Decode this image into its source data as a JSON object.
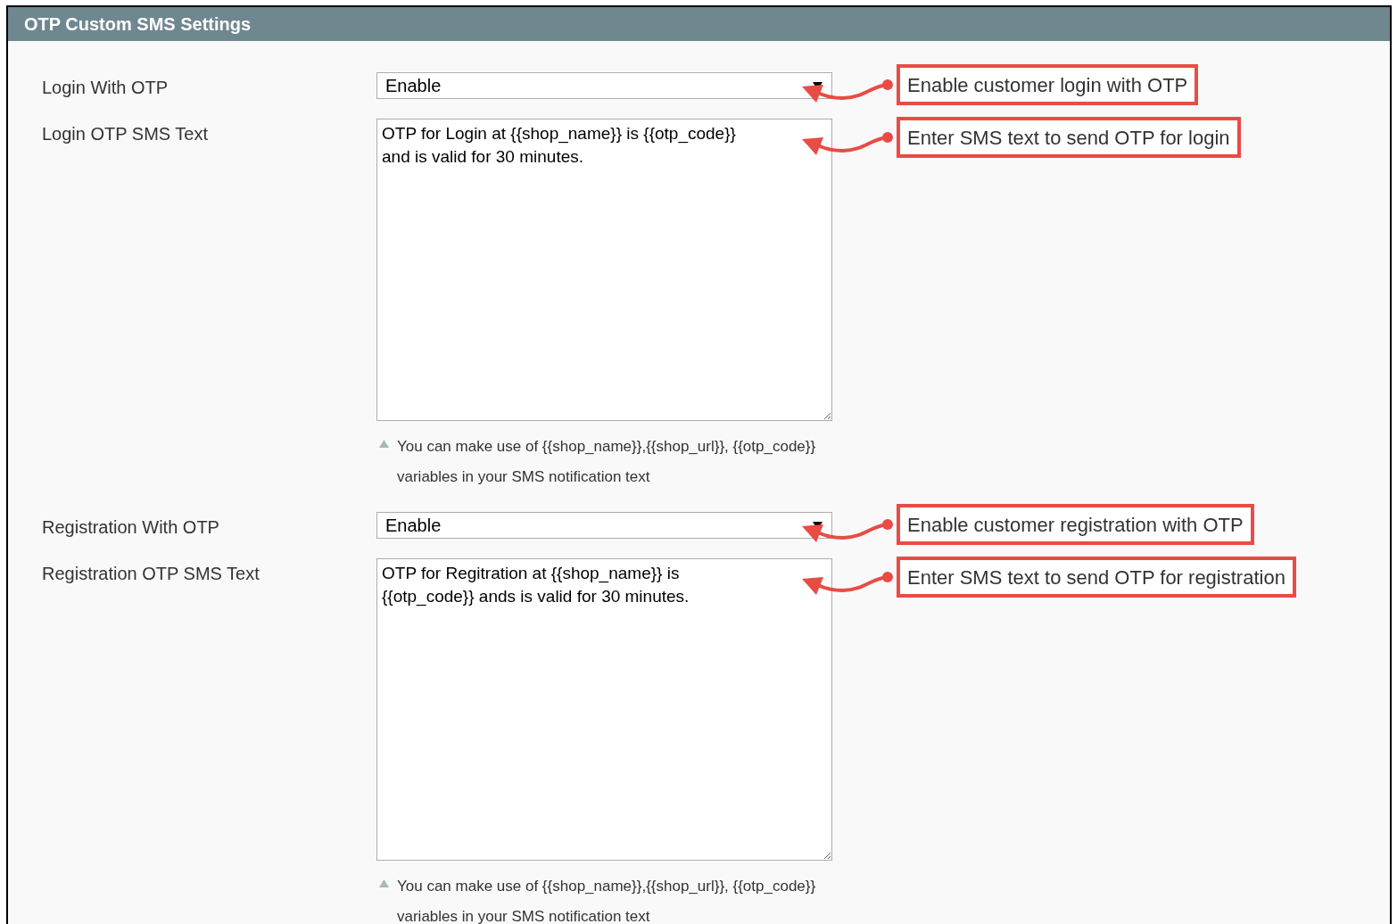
{
  "panel": {
    "title": "OTP Custom SMS Settings"
  },
  "fields": [
    {
      "kind": "select",
      "label": "Login With OTP",
      "value": "Enable",
      "callout": "Enable customer login with OTP"
    },
    {
      "kind": "textarea",
      "label": "Login OTP SMS Text",
      "value": "OTP for Login at {{shop_name}} is {{otp_code}}\nand is valid for 30 minutes.",
      "callout": "Enter SMS text to send OTP for login",
      "note": "You can make use of {{shop_name}},{{shop_url}}, {{otp_code}} variables in your SMS notification text"
    },
    {
      "kind": "select",
      "label": "Registration With OTP",
      "value": "Enable",
      "callout": "Enable customer registration with OTP"
    },
    {
      "kind": "textarea",
      "label": "Registration OTP SMS Text",
      "value": "OTP for Regitration at {{shop_name}} is\n{{otp_code}} ands is valid for 30 minutes.",
      "callout": "Enter SMS text to send OTP for registration",
      "note": "You can make use of {{shop_name}},{{shop_url}}, {{otp_code}} variables in your SMS notification text"
    }
  ]
}
